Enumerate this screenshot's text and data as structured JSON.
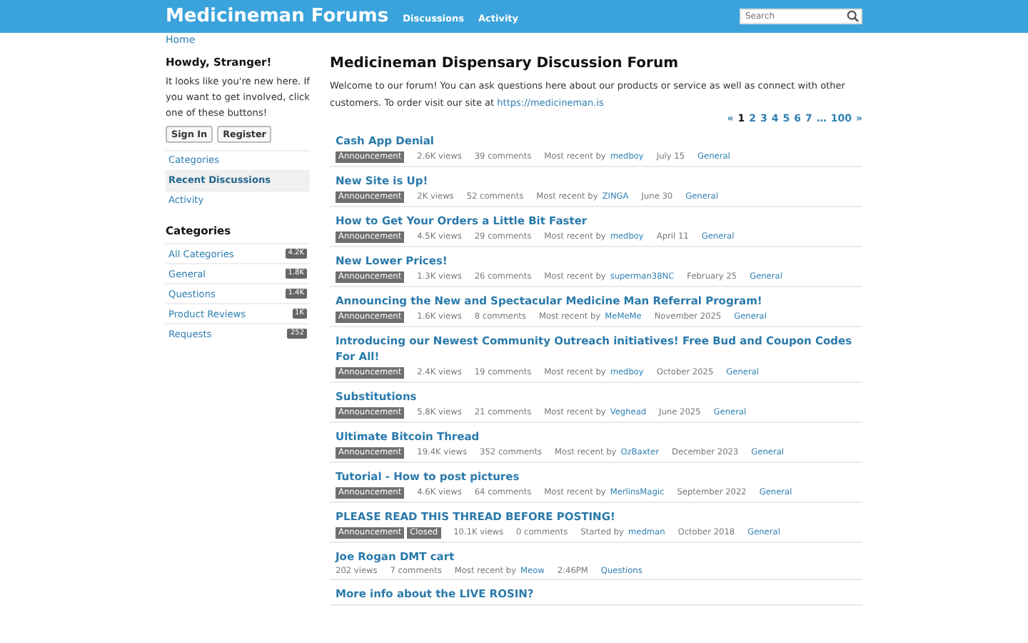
{
  "header": {
    "title": "Medicineman Forums",
    "nav": [
      {
        "label": "Discussions"
      },
      {
        "label": "Activity"
      }
    ],
    "search": {
      "placeholder": "Search"
    }
  },
  "breadcrumb": "Home",
  "sidebar": {
    "greeting": "Howdy, Stranger!",
    "intro": "It looks like you're new here. If you want to get involved, click one of these buttons!",
    "buttons": [
      "Sign In",
      "Register"
    ],
    "nav": [
      {
        "label": "Categories",
        "selected": false
      },
      {
        "label": "Recent Discussions",
        "selected": true
      },
      {
        "label": "Activity",
        "selected": false
      }
    ],
    "categories_title": "Categories",
    "categories": [
      {
        "label": "All Categories",
        "count": "4.2K"
      },
      {
        "label": "General",
        "count": "1.8K"
      },
      {
        "label": "Questions",
        "count": "1.4K"
      },
      {
        "label": "Product Reviews",
        "count": "1K"
      },
      {
        "label": "Requests",
        "count": "252"
      }
    ]
  },
  "main": {
    "title": "Medicineman Dispensary Discussion Forum",
    "intro": "Welcome to our forum! You can ask questions here about our products or service as well as connect with other customers. To order visit our site at",
    "link": "https://medicineman.is",
    "pager": [
      {
        "label": "«",
        "selected": false
      },
      {
        "label": "1",
        "selected": true
      },
      {
        "label": "2",
        "selected": false
      },
      {
        "label": "3",
        "selected": false
      },
      {
        "label": "4",
        "selected": false
      },
      {
        "label": "5",
        "selected": false
      },
      {
        "label": "6",
        "selected": false
      },
      {
        "label": "7",
        "selected": false
      },
      {
        "label": "…",
        "selected": false
      },
      {
        "label": "100",
        "selected": false
      },
      {
        "label": "»",
        "selected": false
      }
    ],
    "discussions": [
      {
        "title": "Cash App Denial",
        "tags": [
          "Announcement"
        ],
        "views": "2.6K views",
        "comments": "39 comments",
        "by": "Most recent by",
        "user": "medboy",
        "date": "July 15",
        "category": "General"
      },
      {
        "title": "New Site is Up!",
        "tags": [
          "Announcement"
        ],
        "views": "2K views",
        "comments": "52 comments",
        "by": "Most recent by",
        "user": "ZINGA",
        "date": "June 30",
        "category": "General"
      },
      {
        "title": "How to Get Your Orders a Little Bit Faster",
        "tags": [
          "Announcement"
        ],
        "views": "4.5K views",
        "comments": "29 comments",
        "by": "Most recent by",
        "user": "medboy",
        "date": "April 11",
        "category": "General"
      },
      {
        "title": "New Lower Prices!",
        "tags": [
          "Announcement"
        ],
        "views": "1.3K views",
        "comments": "26 comments",
        "by": "Most recent by",
        "user": "superman38NC",
        "date": "February 25",
        "category": "General"
      },
      {
        "title": "Announcing the New and Spectacular Medicine Man Referral Program!",
        "tags": [
          "Announcement"
        ],
        "views": "1.6K views",
        "comments": "8 comments",
        "by": "Most recent by",
        "user": "MeMeMe",
        "date": "November 2025",
        "category": "General"
      },
      {
        "title": "Introducing our Newest Community Outreach initiatives! Free Bud and Coupon Codes For All!",
        "tags": [
          "Announcement"
        ],
        "views": "2.4K views",
        "comments": "19 comments",
        "by": "Most recent by",
        "user": "medboy",
        "date": "October 2025",
        "category": "General"
      },
      {
        "title": "Substitutions",
        "tags": [
          "Announcement"
        ],
        "views": "5.8K views",
        "comments": "21 comments",
        "by": "Most recent by",
        "user": "Veghead",
        "date": "June 2025",
        "category": "General"
      },
      {
        "title": "Ultimate Bitcoin Thread",
        "tags": [
          "Announcement"
        ],
        "views": "19.4K views",
        "comments": "352 comments",
        "by": "Most recent by",
        "user": "OzBaxter",
        "date": "December 2023",
        "category": "General"
      },
      {
        "title": "Tutorial - How to post pictures",
        "tags": [
          "Announcement"
        ],
        "views": "4.6K views",
        "comments": "64 comments",
        "by": "Most recent by",
        "user": "MerlinsMagic",
        "date": "September 2022",
        "category": "General"
      },
      {
        "title": "PLEASE READ THIS THREAD BEFORE POSTING!",
        "tags": [
          "Announcement",
          "Closed"
        ],
        "views": "10.1K views",
        "comments": "0 comments",
        "by": "Started by",
        "user": "medman",
        "date": "October 2018",
        "category": "General"
      },
      {
        "title": "Joe Rogan DMT cart",
        "views": "202 views",
        "comments": "7 comments",
        "by": "Most recent by",
        "user": "Meow",
        "date": "2:46PM",
        "category": "Questions"
      },
      {
        "title": "More info about the LIVE ROSIN?"
      }
    ]
  }
}
